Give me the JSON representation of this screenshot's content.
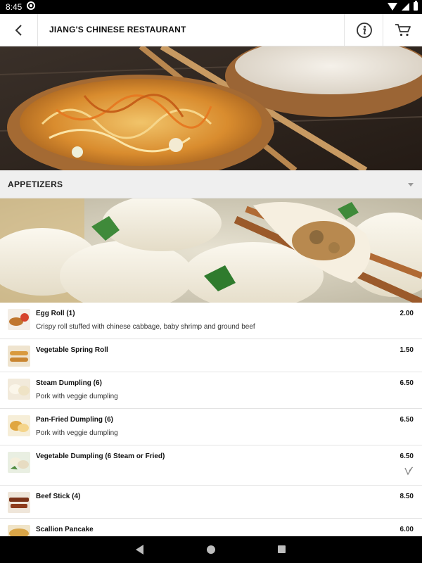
{
  "status_bar": {
    "time": "8:45"
  },
  "header": {
    "title": "JIANG'S CHINESE RESTAURANT",
    "icons": {
      "back": "chevron-left-icon",
      "info": "info-icon",
      "cart": "cart-icon"
    }
  },
  "category": {
    "name": "APPETIZERS",
    "icon": "chevron-down-icon"
  },
  "menu_items": [
    {
      "name": "Egg Roll (1)",
      "price": "2.00",
      "description": "Crispy roll stuffed with chinese cabbage, baby shrimp and ground beef",
      "vegetarian": false
    },
    {
      "name": "Vegetable Spring Roll",
      "price": "1.50",
      "description": "",
      "vegetarian": false
    },
    {
      "name": "Steam Dumpling (6)",
      "price": "6.50",
      "description": "Pork with veggie dumpling",
      "vegetarian": false
    },
    {
      "name": "Pan-Fried Dumpling (6)",
      "price": "6.50",
      "description": "Pork with veggie dumpling",
      "vegetarian": false
    },
    {
      "name": "Vegetable Dumpling (6 Steam or Fried)",
      "price": "6.50",
      "description": "",
      "vegetarian": true
    },
    {
      "name": "Beef Stick (4)",
      "price": "8.50",
      "description": "",
      "vegetarian": false
    },
    {
      "name": "Scallion Pancake",
      "price": "6.00",
      "description": "",
      "vegetarian": false
    }
  ],
  "colors": {
    "accent": "#111111",
    "divider": "#e3e3e3",
    "category_bg": "#efefef"
  }
}
